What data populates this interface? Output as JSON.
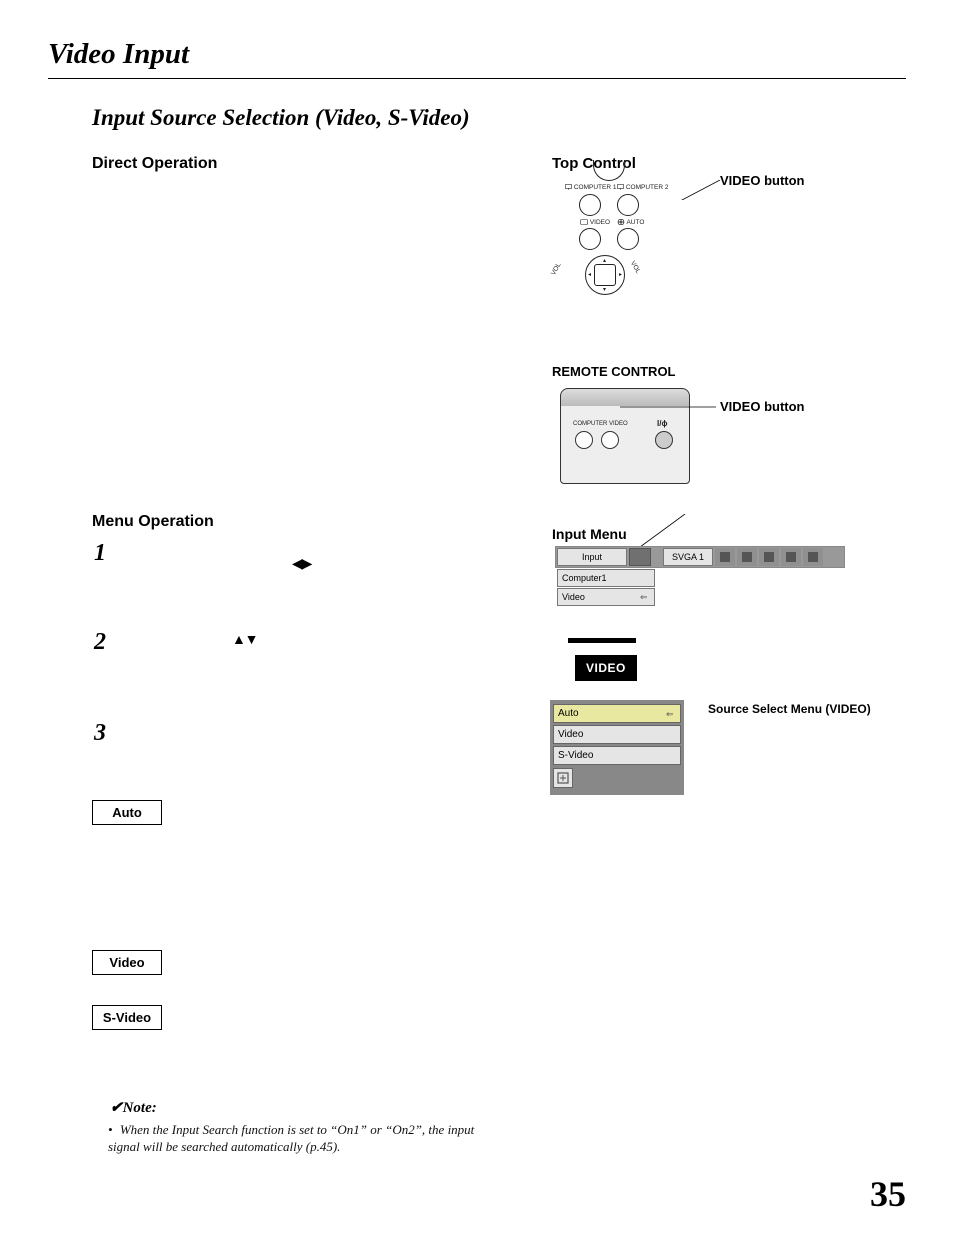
{
  "page_title": "Video Input",
  "section_title": "Input Source Selection (Video, S-Video)",
  "direct_operation": "Direct Operation",
  "top_control": "Top Control",
  "video_button": "VIDEO button",
  "remote_control": "REMOTE CONTROL",
  "menu_operation": "Menu Operation",
  "input_menu": "Input Menu",
  "source_select_menu_label": "Source Select Menu (VIDEO)",
  "video_tag": "VIDEO",
  "steps": [
    "1",
    "2",
    "3"
  ],
  "boxes": {
    "auto": "Auto",
    "video": "Video",
    "svideo": "S-Video"
  },
  "menu": {
    "input_label": "Input",
    "mode": "SVGA 1",
    "items": {
      "computer1": "Computer1",
      "video": "Video"
    }
  },
  "source_menu": {
    "auto": "Auto",
    "video": "Video",
    "svideo": "S-Video"
  },
  "top_control_labels": {
    "c1": "COMPUTER 1",
    "c2": "COMPUTER 2",
    "vid": "VIDEO",
    "auto": "AUTO"
  },
  "remote_labels": {
    "computer": "COMPUTER",
    "video": "VIDEO",
    "power_glyph": "I/ϕ"
  },
  "note_heading": "Note:",
  "note_text": "When the Input Search function is set to “On1” or “On2”, the input signal will be searched automatically (p.45).",
  "arrows_lr": "◀ ▶",
  "arrows_ud": "▲ ▼",
  "checkmark": "✔",
  "bullet": "•",
  "page_number": "35"
}
